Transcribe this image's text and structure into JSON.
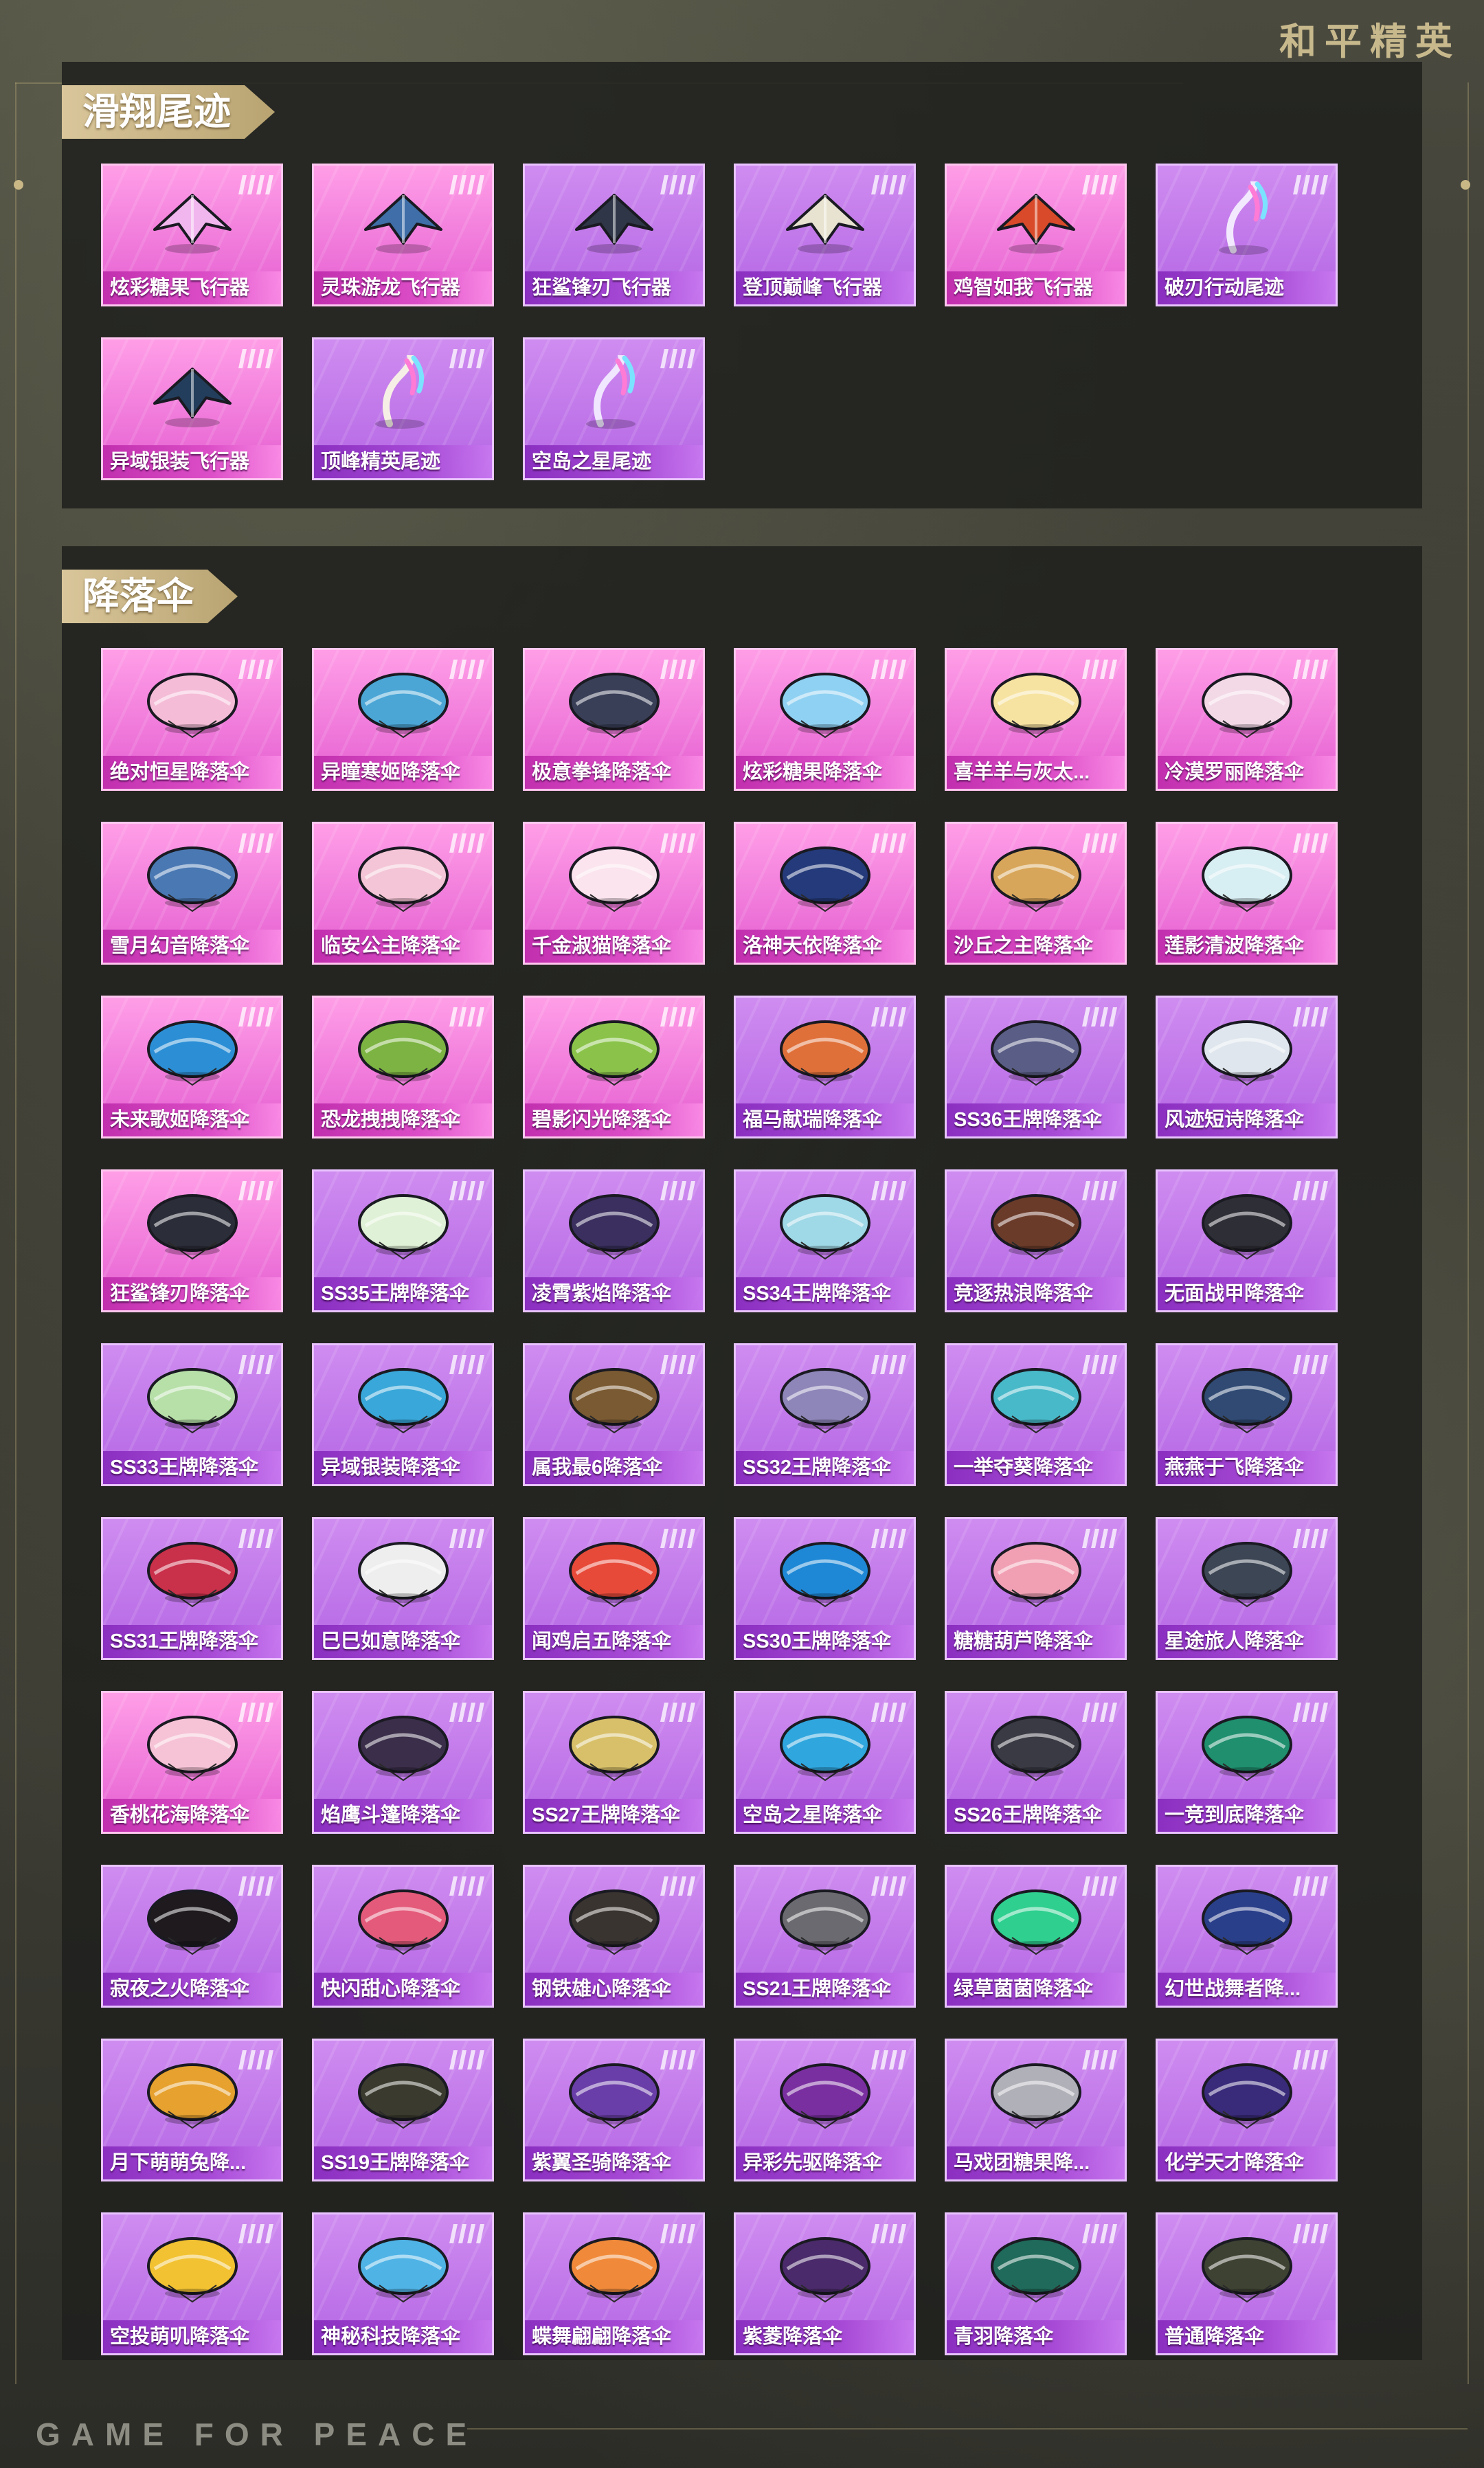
{
  "header": {
    "logo_text": "和平精英"
  },
  "footer": {
    "logo_text": "GAME FOR PEACE"
  },
  "sections": [
    {
      "title": "滑翔尾迹",
      "items": [
        {
          "name": "炫彩糖果飞行器",
          "rarity": "pink",
          "icon": "glider-icon",
          "color": "#f2b6ee"
        },
        {
          "name": "灵珠游龙飞行器",
          "rarity": "pink",
          "icon": "glider-icon",
          "color": "#3f6ea8"
        },
        {
          "name": "狂鲨锋刃飞行器",
          "rarity": "purple",
          "icon": "glider-icon",
          "color": "#2f3647"
        },
        {
          "name": "登顶巅峰飞行器",
          "rarity": "purple",
          "icon": "glider-icon",
          "color": "#e8e2d0"
        },
        {
          "name": "鸡智如我飞行器",
          "rarity": "pink",
          "icon": "glider-icon",
          "color": "#d94a2a"
        },
        {
          "name": "破刃行动尾迹",
          "rarity": "purple",
          "icon": "trail-icon",
          "color": "#f3e9ff"
        },
        {
          "name": "异域银装飞行器",
          "rarity": "pink",
          "icon": "glider-icon",
          "color": "#233e5c"
        },
        {
          "name": "顶峰精英尾迹",
          "rarity": "purple",
          "icon": "trail-icon",
          "color": "#f6efe6"
        },
        {
          "name": "空岛之星尾迹",
          "rarity": "purple",
          "icon": "trail-icon",
          "color": "#f0e6ff"
        }
      ]
    },
    {
      "title": "降落伞",
      "items": [
        {
          "name": "绝对恒星降落伞",
          "rarity": "pink",
          "icon": "parachute-icon",
          "color": "#f5bcd7"
        },
        {
          "name": "异瞳寒姬降落伞",
          "rarity": "pink",
          "icon": "parachute-icon",
          "color": "#4ba6d6"
        },
        {
          "name": "极意拳锋降落伞",
          "rarity": "pink",
          "icon": "parachute-icon",
          "color": "#3a3f58"
        },
        {
          "name": "炫彩糖果降落伞",
          "rarity": "pink",
          "icon": "parachute-icon",
          "color": "#8fd1f2"
        },
        {
          "name": "喜羊羊与灰太...",
          "rarity": "pink",
          "icon": "parachute-icon",
          "color": "#f7e3a1"
        },
        {
          "name": "冷漠罗丽降落伞",
          "rarity": "pink",
          "icon": "parachute-icon",
          "color": "#f3d9e6"
        },
        {
          "name": "雪月幻音降落伞",
          "rarity": "pink",
          "icon": "parachute-icon",
          "color": "#4a78b3"
        },
        {
          "name": "临安公主降落伞",
          "rarity": "pink",
          "icon": "parachute-icon",
          "color": "#f4c5d6"
        },
        {
          "name": "千金淑猫降落伞",
          "rarity": "pink",
          "icon": "parachute-icon",
          "color": "#fbe4ee"
        },
        {
          "name": "洛神天依降落伞",
          "rarity": "pink",
          "icon": "parachute-icon",
          "color": "#243a7a"
        },
        {
          "name": "沙丘之主降落伞",
          "rarity": "pink",
          "icon": "parachute-icon",
          "color": "#d8a65a"
        },
        {
          "name": "莲影清波降落伞",
          "rarity": "pink",
          "icon": "parachute-icon",
          "color": "#d7eef2"
        },
        {
          "name": "未来歌姬降落伞",
          "rarity": "pink",
          "icon": "parachute-icon",
          "color": "#2c8fd6"
        },
        {
          "name": "恐龙拽拽降落伞",
          "rarity": "pink",
          "icon": "parachute-icon",
          "color": "#7cb342"
        },
        {
          "name": "碧影闪光降落伞",
          "rarity": "pink",
          "icon": "parachute-icon",
          "color": "#8bc34a"
        },
        {
          "name": "福马献瑞降落伞",
          "rarity": "purple",
          "icon": "parachute-icon",
          "color": "#e0703a"
        },
        {
          "name": "SS36王牌降落伞",
          "rarity": "purple",
          "icon": "parachute-icon",
          "color": "#5a5e86"
        },
        {
          "name": "风迹短诗降落伞",
          "rarity": "purple",
          "icon": "parachute-icon",
          "color": "#dfe6ee"
        },
        {
          "name": "狂鲨锋刃降落伞",
          "rarity": "pink",
          "icon": "parachute-icon",
          "color": "#2b2d38"
        },
        {
          "name": "SS35王牌降落伞",
          "rarity": "purple",
          "icon": "parachute-icon",
          "color": "#dff1d6"
        },
        {
          "name": "凌霄紫焰降落伞",
          "rarity": "purple",
          "icon": "parachute-icon",
          "color": "#3a2f5e"
        },
        {
          "name": "SS34王牌降落伞",
          "rarity": "purple",
          "icon": "parachute-icon",
          "color": "#9fd8e6"
        },
        {
          "name": "竞逐热浪降落伞",
          "rarity": "purple",
          "icon": "parachute-icon",
          "color": "#6b3b2a"
        },
        {
          "name": "无面战甲降落伞",
          "rarity": "purple",
          "icon": "parachute-icon",
          "color": "#2e2e36"
        },
        {
          "name": "SS33王牌降落伞",
          "rarity": "purple",
          "icon": "parachute-icon",
          "color": "#b7e0a8"
        },
        {
          "name": "异域银装降落伞",
          "rarity": "purple",
          "icon": "parachute-icon",
          "color": "#39a7d9"
        },
        {
          "name": "属我最6降落伞",
          "rarity": "purple",
          "icon": "parachute-icon",
          "color": "#7a5a32"
        },
        {
          "name": "SS32王牌降落伞",
          "rarity": "purple",
          "icon": "parachute-icon",
          "color": "#8e86b8"
        },
        {
          "name": "一举夺葵降落伞",
          "rarity": "purple",
          "icon": "parachute-icon",
          "color": "#48b9c9"
        },
        {
          "name": "燕燕于飞降落伞",
          "rarity": "purple",
          "icon": "parachute-icon",
          "color": "#304a73"
        },
        {
          "name": "SS31王牌降落伞",
          "rarity": "purple",
          "icon": "parachute-icon",
          "color": "#c9304a"
        },
        {
          "name": "巳巳如意降落伞",
          "rarity": "purple",
          "icon": "parachute-icon",
          "color": "#eeeeee"
        },
        {
          "name": "闻鸡启五降落伞",
          "rarity": "purple",
          "icon": "parachute-icon",
          "color": "#e84a3a"
        },
        {
          "name": "SS30王牌降落伞",
          "rarity": "purple",
          "icon": "parachute-icon",
          "color": "#1e88d6"
        },
        {
          "name": "糖糖葫芦降落伞",
          "rarity": "purple",
          "icon": "parachute-icon",
          "color": "#f1a0b4"
        },
        {
          "name": "星途旅人降落伞",
          "rarity": "purple",
          "icon": "parachute-icon",
          "color": "#3c4654"
        },
        {
          "name": "香桃花海降落伞",
          "rarity": "pink",
          "icon": "parachute-icon",
          "color": "#f6c3d6"
        },
        {
          "name": "焰鹰斗篷降落伞",
          "rarity": "purple",
          "icon": "parachute-icon",
          "color": "#3a2e4a"
        },
        {
          "name": "SS27王牌降落伞",
          "rarity": "purple",
          "icon": "parachute-icon",
          "color": "#d8c06a"
        },
        {
          "name": "空岛之星降落伞",
          "rarity": "purple",
          "icon": "parachute-icon",
          "color": "#2fa6de"
        },
        {
          "name": "SS26王牌降落伞",
          "rarity": "purple",
          "icon": "parachute-icon",
          "color": "#3a3a44"
        },
        {
          "name": "一竞到底降落伞",
          "rarity": "purple",
          "icon": "parachute-icon",
          "color": "#1f8f6e"
        },
        {
          "name": "寂夜之火降落伞",
          "rarity": "purple",
          "icon": "parachute-icon",
          "color": "#1e1a1e"
        },
        {
          "name": "快闪甜心降落伞",
          "rarity": "purple",
          "icon": "parachute-icon",
          "color": "#e45a7a"
        },
        {
          "name": "钢铁雄心降落伞",
          "rarity": "purple",
          "icon": "parachute-icon",
          "color": "#3a3430"
        },
        {
          "name": "SS21王牌降落伞",
          "rarity": "purple",
          "icon": "parachute-icon",
          "color": "#6a6a70"
        },
        {
          "name": "绿草菌菌降落伞",
          "rarity": "purple",
          "icon": "parachute-icon",
          "color": "#2fcf8f"
        },
        {
          "name": "幻世战舞者降...",
          "rarity": "purple",
          "icon": "parachute-icon",
          "color": "#2a3f8a"
        },
        {
          "name": "月下萌萌兔降...",
          "rarity": "purple",
          "icon": "parachute-icon",
          "color": "#e6a12e"
        },
        {
          "name": "SS19王牌降落伞",
          "rarity": "purple",
          "icon": "parachute-icon",
          "color": "#3a3a2e"
        },
        {
          "name": "紫翼圣骑降落伞",
          "rarity": "purple",
          "icon": "parachute-icon",
          "color": "#6a3ea8"
        },
        {
          "name": "异彩先驱降落伞",
          "rarity": "purple",
          "icon": "parachute-icon",
          "color": "#7a2fa0"
        },
        {
          "name": "马戏团糖果降...",
          "rarity": "purple",
          "icon": "parachute-icon",
          "color": "#b0b0b8"
        },
        {
          "name": "化学天才降落伞",
          "rarity": "purple",
          "icon": "parachute-icon",
          "color": "#3a2a7a"
        },
        {
          "name": "空投萌叽降落伞",
          "rarity": "purple",
          "icon": "parachute-icon",
          "color": "#f2c232"
        },
        {
          "name": "神秘科技降落伞",
          "rarity": "purple",
          "icon": "parachute-icon",
          "color": "#4fb3e6"
        },
        {
          "name": "蝶舞翩翩降落伞",
          "rarity": "purple",
          "icon": "parachute-icon",
          "color": "#f08a3a"
        },
        {
          "name": "紫菱降落伞",
          "rarity": "purple",
          "icon": "parachute-icon",
          "color": "#4a2a6a"
        },
        {
          "name": "青羽降落伞",
          "rarity": "purple",
          "icon": "parachute-icon",
          "color": "#1f6a5a"
        },
        {
          "name": "普通降落伞",
          "rarity": "purple",
          "icon": "parachute-icon",
          "color": "#3e4232"
        }
      ]
    }
  ]
}
